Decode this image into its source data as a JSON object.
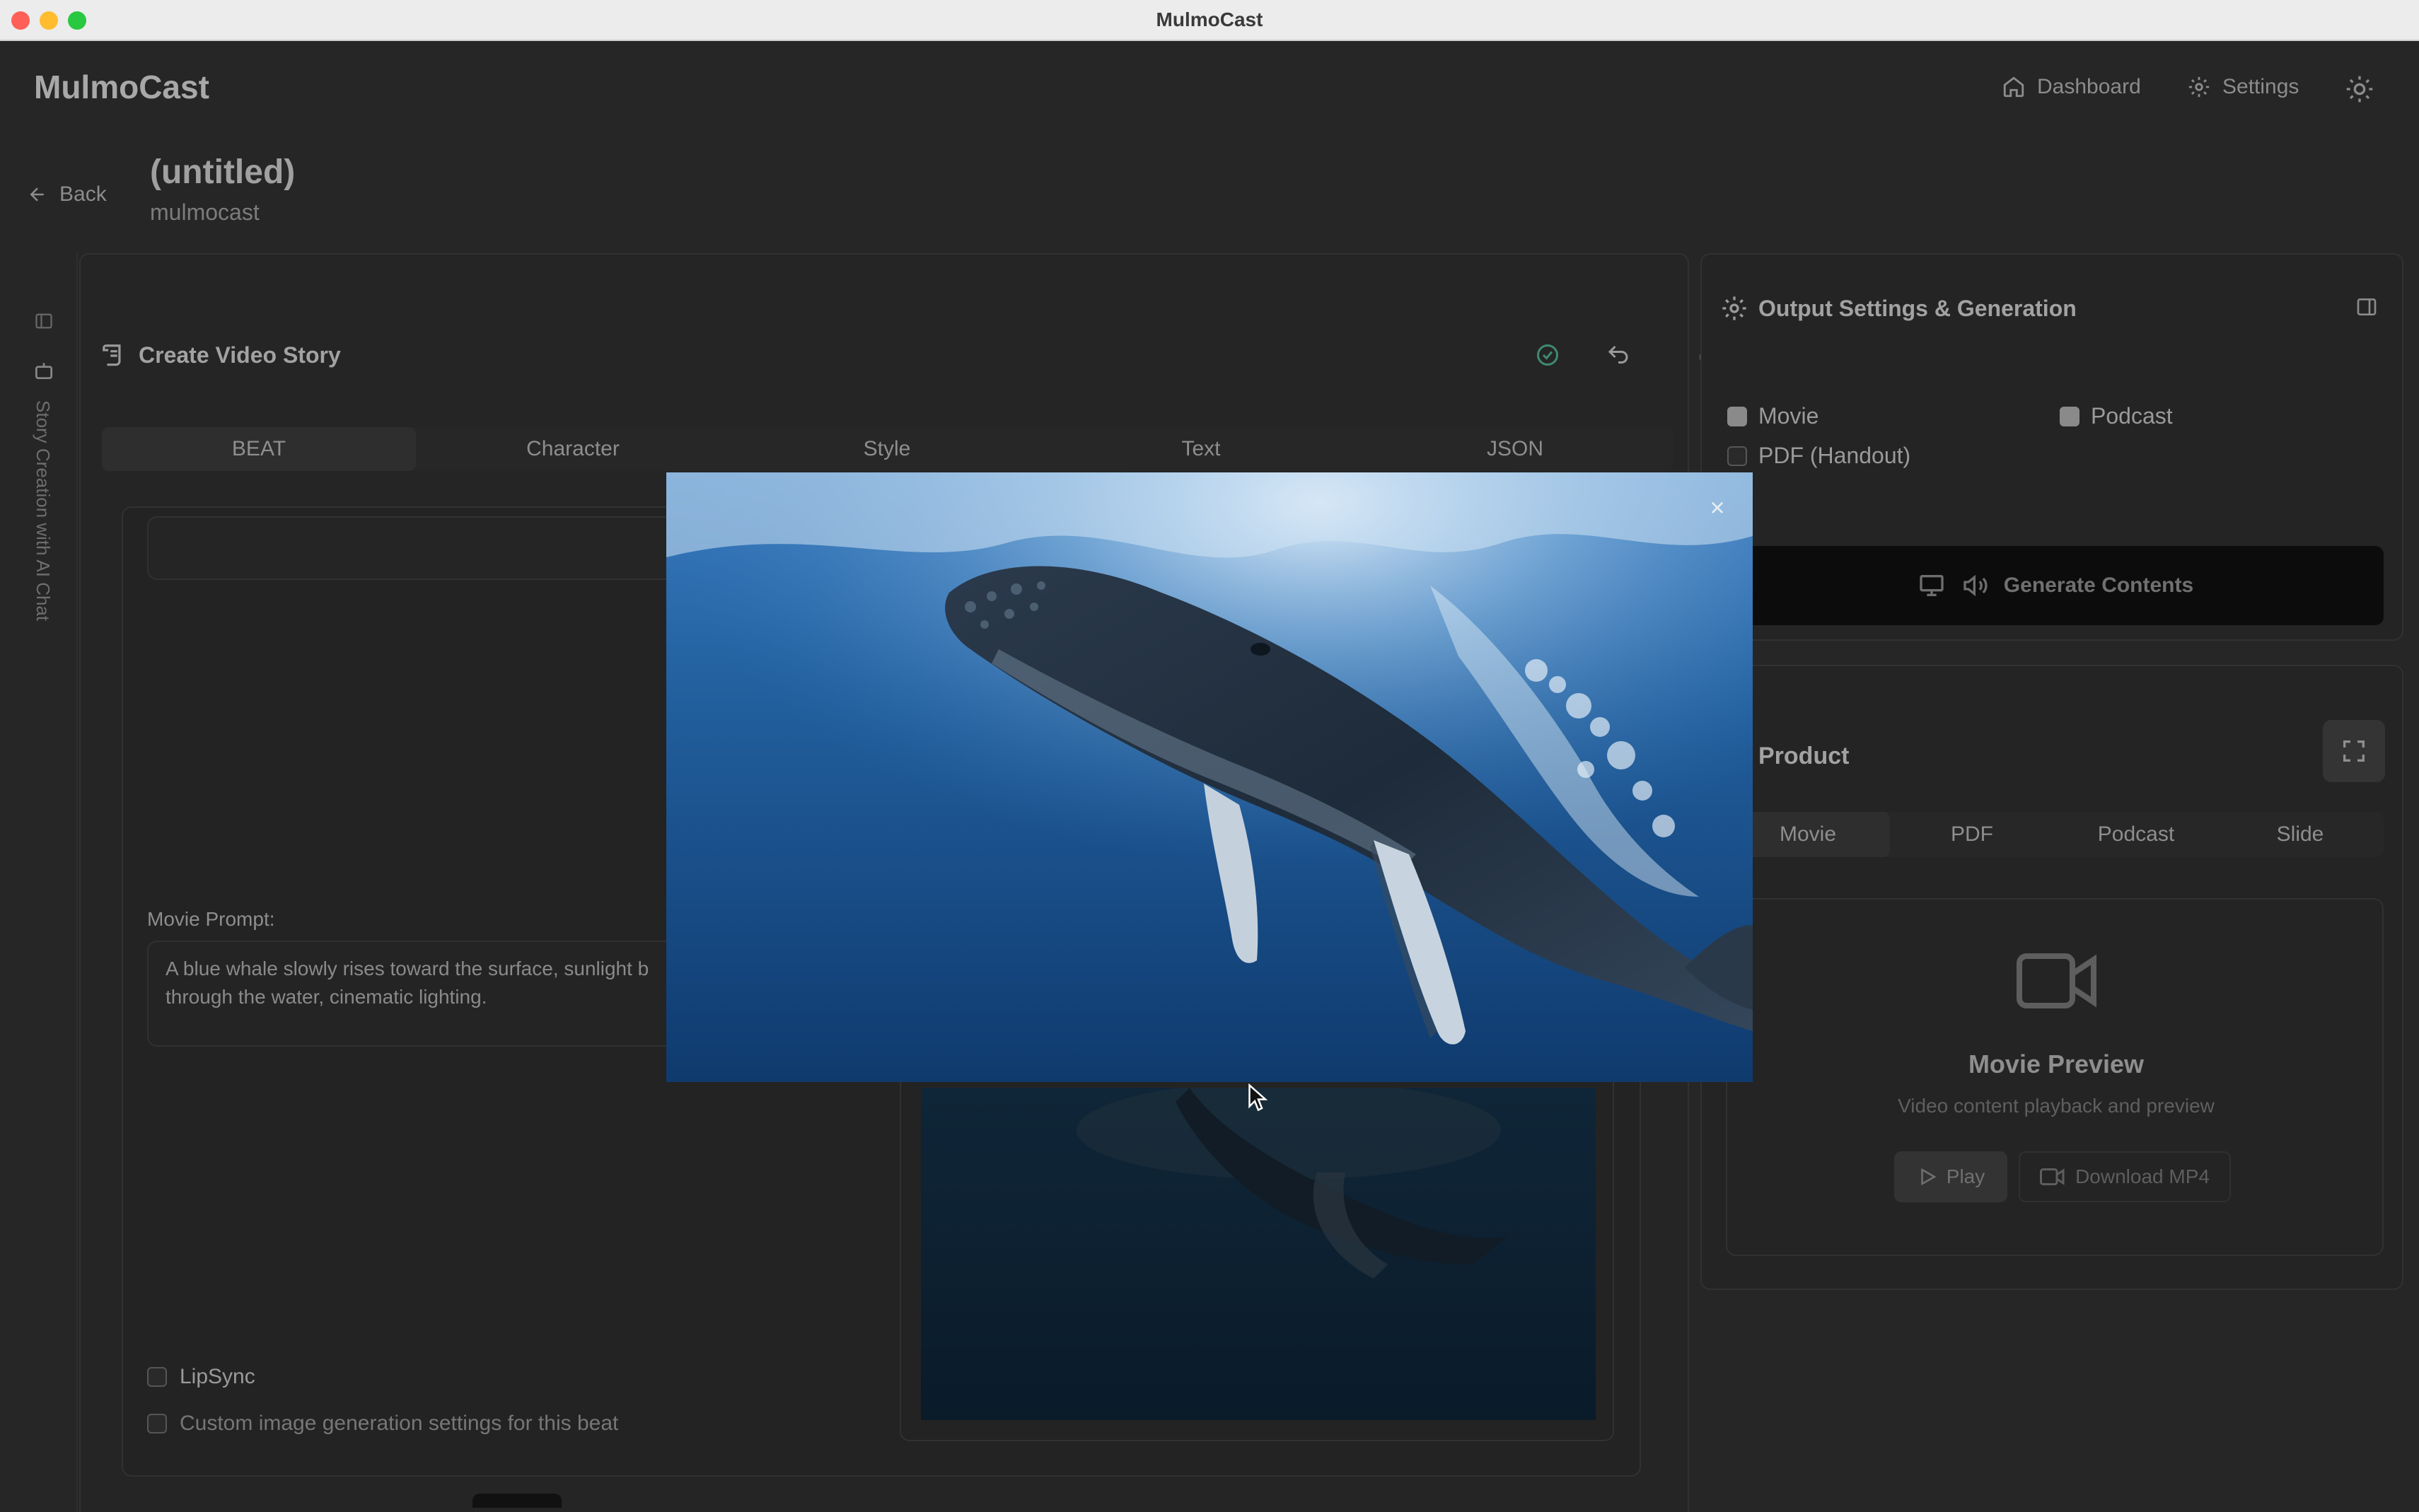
{
  "window": {
    "title": "MulmoCast"
  },
  "header": {
    "brand": "MulmoCast",
    "nav": [
      {
        "label": "Dashboard",
        "icon": "home-icon"
      },
      {
        "label": "Settings",
        "icon": "gear-icon"
      }
    ],
    "theme_icon": "sun-icon"
  },
  "project": {
    "back_label": "Back",
    "title": "(untitled)",
    "subtitle": "mulmocast"
  },
  "sidebar": {
    "vertical_label": "Story Creation with AI Chat"
  },
  "editor": {
    "title": "Create Video Story",
    "tabs": [
      "BEAT",
      "Character",
      "Style",
      "Text",
      "JSON"
    ],
    "active_tab": "BEAT",
    "movie_prompt_label": "Movie Prompt:",
    "movie_prompt_text": "A blue whale slowly rises toward the surface, sunlight b\nthrough the water, cinematic lighting.",
    "lipsync_label": "LipSync",
    "custom_settings_label": "Custom image generation settings for this beat"
  },
  "output": {
    "title": "Output Settings & Generation",
    "options": [
      {
        "label": "Movie",
        "checked": true
      },
      {
        "label": "Podcast",
        "checked": true
      },
      {
        "label": "PDF (Handout)",
        "checked": false
      }
    ],
    "generate_label": "Generate Contents"
  },
  "product": {
    "title": "Product",
    "tabs": [
      "Movie",
      "PDF",
      "Podcast",
      "Slide"
    ],
    "active_tab": "Movie",
    "preview_title": "Movie Preview",
    "preview_subtitle": "Video content playback and preview",
    "play_label": "Play",
    "download_label": "Download MP4"
  },
  "modal": {
    "image_subject": "humpback whale underwater",
    "close_icon": "close-icon"
  },
  "colors": {
    "overlay": "#262626",
    "ocean_deep": "#0f3a6e",
    "ocean_light": "#3a7cc0"
  }
}
